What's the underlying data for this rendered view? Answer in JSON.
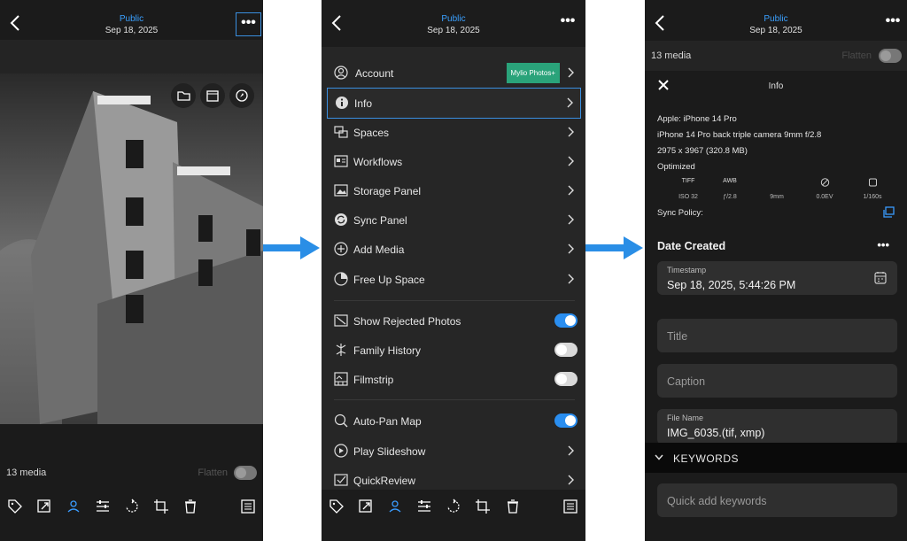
{
  "header": {
    "title": "Public",
    "date": "Sep 18, 2025"
  },
  "media": {
    "count": "13 media",
    "flatten_label": "Flatten"
  },
  "menu": {
    "badge": "Mylio Photos+",
    "items": [
      {
        "label": "Account"
      },
      {
        "label": "Info"
      },
      {
        "label": "Spaces"
      },
      {
        "label": "Workflows"
      },
      {
        "label": "Storage Panel"
      },
      {
        "label": "Sync Panel"
      },
      {
        "label": "Add Media"
      },
      {
        "label": "Free Up Space"
      }
    ],
    "toggles": [
      {
        "label": "Show Rejected Photos",
        "on": true
      },
      {
        "label": "Family History",
        "on": false
      },
      {
        "label": "Filmstrip",
        "on": false
      }
    ],
    "more": [
      {
        "label": "Auto-Pan Map",
        "on": true
      },
      {
        "label": "Play Slideshow"
      },
      {
        "label": "QuickReview"
      }
    ]
  },
  "info": {
    "title": "Info",
    "camera": "Apple: iPhone 14 Pro",
    "lens": "iPhone 14 Pro back triple camera 9mm f/2.8",
    "dimensions": "2975 x 3967 (320.8 MB)",
    "status": "Optimized",
    "exif_heads": [
      "TIFF",
      "AWB",
      "",
      ""
    ],
    "exif_values": [
      "ISO 32",
      "ƒ/2.8",
      "9mm",
      "0.0EV",
      "1/160s"
    ],
    "sync_policy": "Sync Policy:",
    "date_created": "Date Created",
    "timestamp_label": "Timestamp",
    "timestamp_value": "Sep 18, 2025, 5:44:26 PM",
    "title_placeholder": "Title",
    "caption_placeholder": "Caption",
    "filename_label": "File Name",
    "filename_value": "IMG_6035.(tif, xmp)",
    "keywords_label": "KEYWORDS",
    "keywords_placeholder": "Quick add keywords"
  },
  "colors": {
    "accent": "#3a8fe0",
    "badge": "#2aa37a",
    "arrow": "#2a8ee6"
  }
}
